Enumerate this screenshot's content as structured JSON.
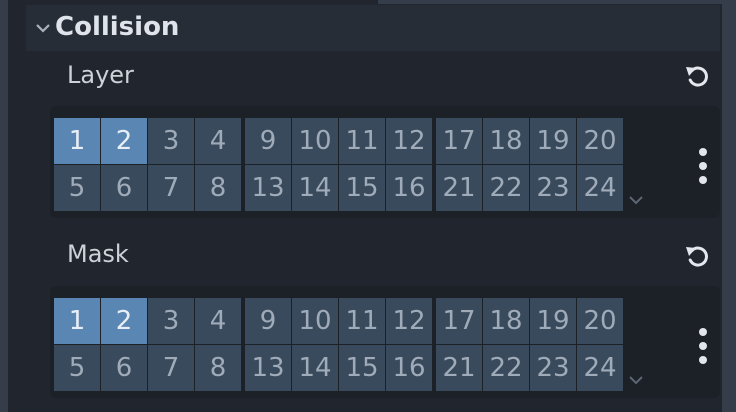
{
  "section": {
    "title": "Collision",
    "icon": "chevron-down-icon"
  },
  "layer": {
    "label": "Layer",
    "revert_icon": "reload-icon",
    "menu_icon": "vertical-dots-icon",
    "expand_icon": "chevron-down-icon",
    "groups": [
      {
        "bits": [
          "1",
          "2",
          "3",
          "4",
          "5",
          "6",
          "7",
          "8"
        ],
        "on": [
          true,
          true,
          false,
          false,
          false,
          false,
          false,
          false
        ]
      },
      {
        "bits": [
          "9",
          "10",
          "11",
          "12",
          "13",
          "14",
          "15",
          "16"
        ],
        "on": [
          false,
          false,
          false,
          false,
          false,
          false,
          false,
          false
        ]
      },
      {
        "bits": [
          "17",
          "18",
          "19",
          "20",
          "21",
          "22",
          "23",
          "24"
        ],
        "on": [
          false,
          false,
          false,
          false,
          false,
          false,
          false,
          false
        ]
      }
    ]
  },
  "mask": {
    "label": "Mask",
    "revert_icon": "reload-icon",
    "menu_icon": "vertical-dots-icon",
    "expand_icon": "chevron-down-icon",
    "groups": [
      {
        "bits": [
          "1",
          "2",
          "3",
          "4",
          "5",
          "6",
          "7",
          "8"
        ],
        "on": [
          true,
          true,
          false,
          false,
          false,
          false,
          false,
          false
        ]
      },
      {
        "bits": [
          "9",
          "10",
          "11",
          "12",
          "13",
          "14",
          "15",
          "16"
        ],
        "on": [
          false,
          false,
          false,
          false,
          false,
          false,
          false,
          false
        ]
      },
      {
        "bits": [
          "17",
          "18",
          "19",
          "20",
          "21",
          "22",
          "23",
          "24"
        ],
        "on": [
          false,
          false,
          false,
          false,
          false,
          false,
          false,
          false
        ]
      }
    ]
  },
  "colors": {
    "bit_on": "#5a86b4",
    "bit_off": "#394a5d",
    "panel": "#21262e",
    "editor_bg": "#1c2027"
  }
}
